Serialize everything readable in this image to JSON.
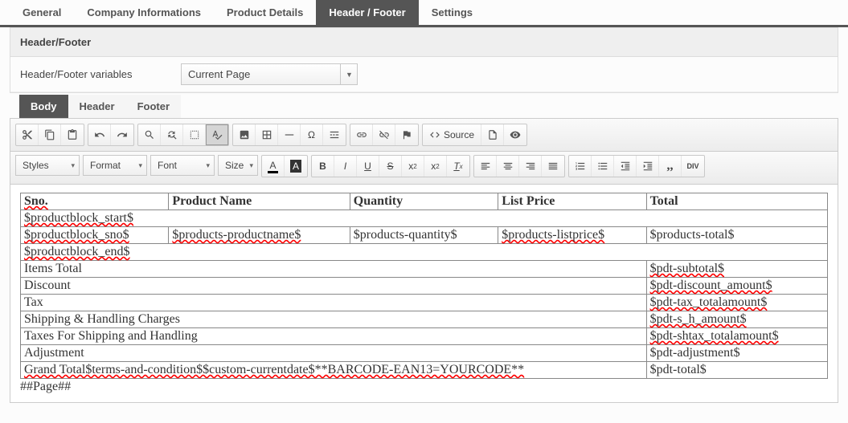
{
  "tabs": {
    "general": "General",
    "company": "Company Informations",
    "product": "Product Details",
    "header_footer": "Header / Footer",
    "settings": "Settings"
  },
  "panel": {
    "title": "Header/Footer",
    "var_label": "Header/Footer variables",
    "var_value": "Current Page"
  },
  "subtabs": {
    "body": "Body",
    "header": "Header",
    "footer": "Footer"
  },
  "toolbar": {
    "source": "Source",
    "styles": "Styles",
    "format": "Format",
    "font": "Font",
    "size": "Size"
  },
  "table": {
    "headers": {
      "sno": "Sno.",
      "name": "Product Name",
      "qty": "Quantity",
      "price": "List Price",
      "total": "Total"
    },
    "block_start": "$productblock_start$",
    "row": {
      "sno": "$productblock_sno$",
      "name": "$products-productname$",
      "qty": "$products-quantity$",
      "price": "$products-listprice$",
      "total": "$products-total$"
    },
    "block_end": "$productblock_end$",
    "items_total": {
      "label": "Items Total",
      "value": "$pdt-subtotal$"
    },
    "discount": {
      "label": "Discount",
      "value": "$pdt-discount_amount$"
    },
    "tax": {
      "label": "Tax",
      "value": "$pdt-tax_totalamount$"
    },
    "shipping": {
      "label": "Shipping & Handling Charges",
      "value": "$pdt-s_h_amount$"
    },
    "shiptax": {
      "label": "Taxes For Shipping and Handling",
      "value": "$pdt-shtax_totalamount$"
    },
    "adjustment": {
      "label": "Adjustment",
      "value": "$pdt-adjustment$"
    },
    "grand": {
      "label": "Grand Total$terms-and-condition$$custom-currentdate$**BARCODE-EAN13=YOURCODE**",
      "value": "$pdt-total$"
    }
  },
  "page_marker": "##Page##"
}
